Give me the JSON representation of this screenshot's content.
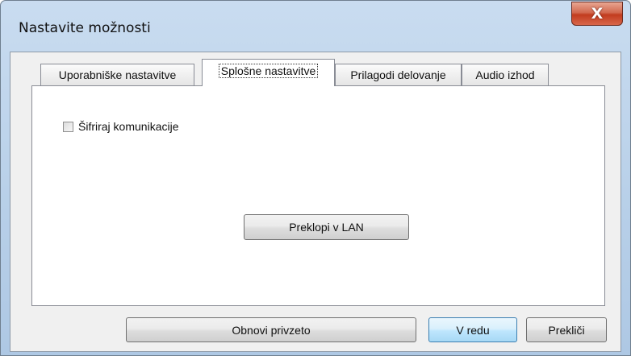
{
  "window": {
    "title": "Nastavite možnosti",
    "close_label": "X"
  },
  "tabs": [
    {
      "label": "Uporabniške nastavitve",
      "active": false
    },
    {
      "label": "Splošne nastavitve",
      "active": true
    },
    {
      "label": "Prilagodi delovanje",
      "active": false
    },
    {
      "label": "Audio izhod",
      "active": false
    }
  ],
  "panel": {
    "encrypt_checkbox": {
      "label": "Šifriraj komunikacije",
      "checked": false
    },
    "switch_lan_label": "Preklopi v LAN"
  },
  "footer": {
    "restore_defaults_label": "Obnovi privzeto",
    "ok_label": "V redu",
    "cancel_label": "Prekliči"
  },
  "colors": {
    "titlebar": "#c9dcf0",
    "close_button": "#c23c1f",
    "client_bg": "#f0f0f0",
    "default_button_border": "#3c7fb1"
  },
  "icons": {
    "close": "close-icon"
  }
}
